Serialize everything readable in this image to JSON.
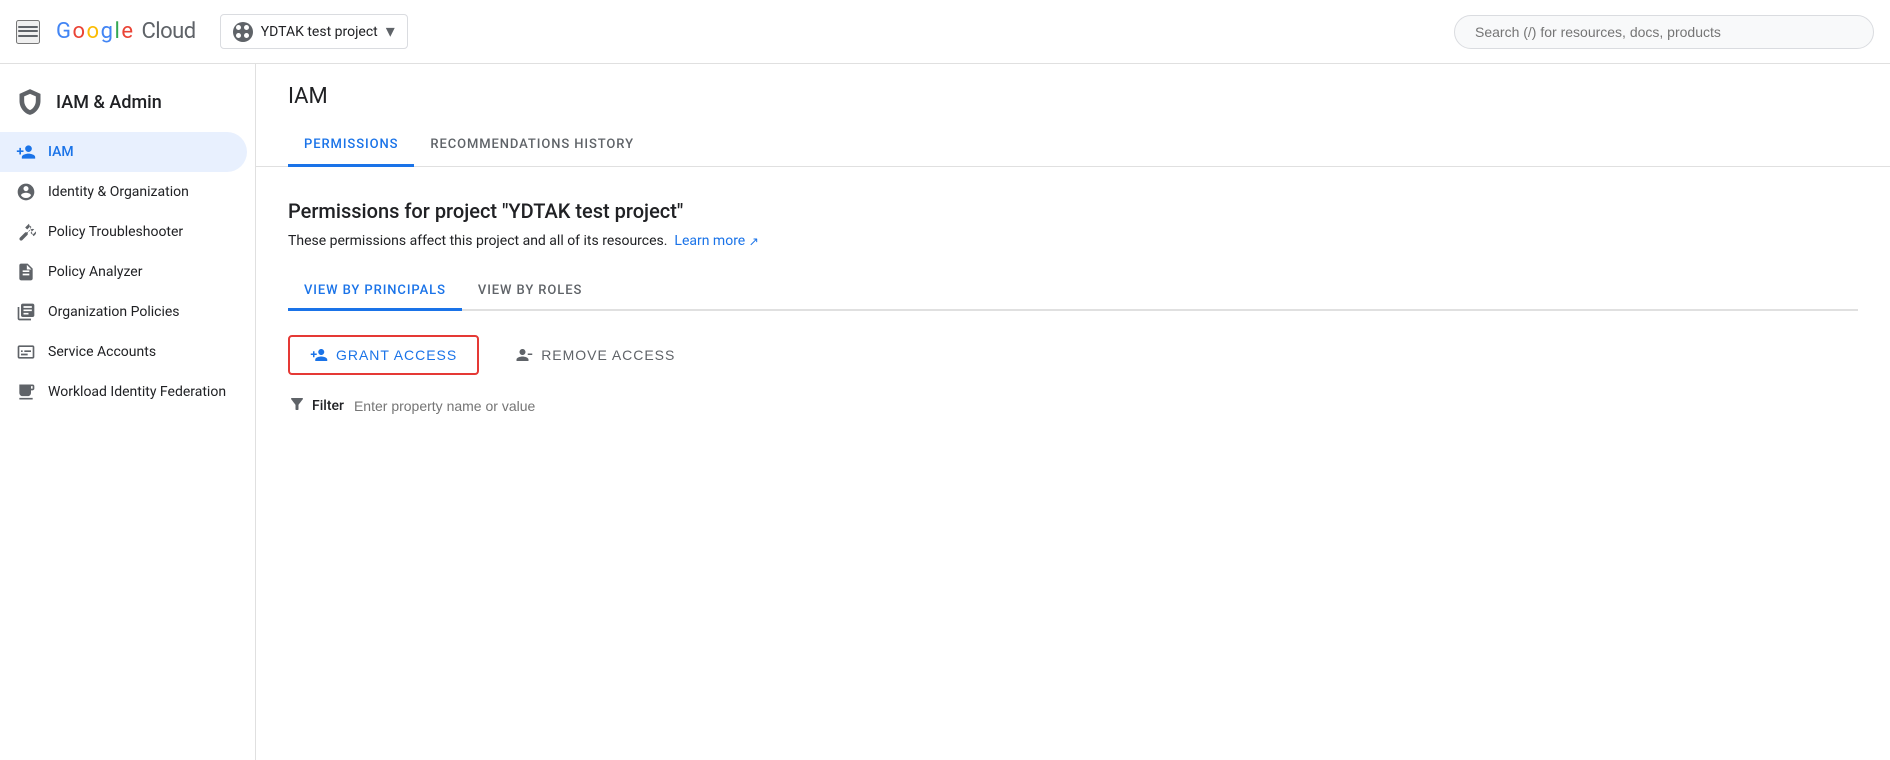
{
  "topbar": {
    "menu_label": "Main menu",
    "logo": {
      "google": "Google",
      "cloud": "Cloud"
    },
    "project": {
      "name": "YDTAK test project",
      "dropdown_label": "▼"
    },
    "search_placeholder": "Search (/) for resources, docs, products"
  },
  "sidebar": {
    "header": {
      "title": "IAM & Admin"
    },
    "items": [
      {
        "id": "iam",
        "label": "IAM",
        "icon": "person-add-icon",
        "active": true
      },
      {
        "id": "identity-organization",
        "label": "Identity & Organization",
        "icon": "account-circle-icon",
        "active": false
      },
      {
        "id": "policy-troubleshooter",
        "label": "Policy Troubleshooter",
        "icon": "wrench-icon",
        "active": false
      },
      {
        "id": "policy-analyzer",
        "label": "Policy Analyzer",
        "icon": "document-search-icon",
        "active": false
      },
      {
        "id": "organization-policies",
        "label": "Organization Policies",
        "icon": "list-icon",
        "active": false
      },
      {
        "id": "service-accounts",
        "label": "Service Accounts",
        "icon": "monitor-icon",
        "active": false
      },
      {
        "id": "workload-identity-federation",
        "label": "Workload Identity Federation",
        "icon": "monitor-code-icon",
        "active": false
      }
    ]
  },
  "main": {
    "title": "IAM",
    "tabs": [
      {
        "id": "permissions",
        "label": "PERMISSIONS",
        "active": true
      },
      {
        "id": "recommendations-history",
        "label": "RECOMMENDATIONS HISTORY",
        "active": false
      }
    ],
    "permissions": {
      "title": "Permissions for project \"YDTAK test project\"",
      "description": "These permissions affect this project and all of its resources.",
      "learn_more_label": "Learn more",
      "sub_tabs": [
        {
          "id": "view-by-principals",
          "label": "VIEW BY PRINCIPALS",
          "active": true
        },
        {
          "id": "view-by-roles",
          "label": "VIEW BY ROLES",
          "active": false
        }
      ],
      "actions": {
        "grant_label": "GRANT ACCESS",
        "remove_label": "REMOVE ACCESS"
      },
      "filter": {
        "label": "Filter",
        "placeholder": "Enter property name or value"
      }
    }
  }
}
